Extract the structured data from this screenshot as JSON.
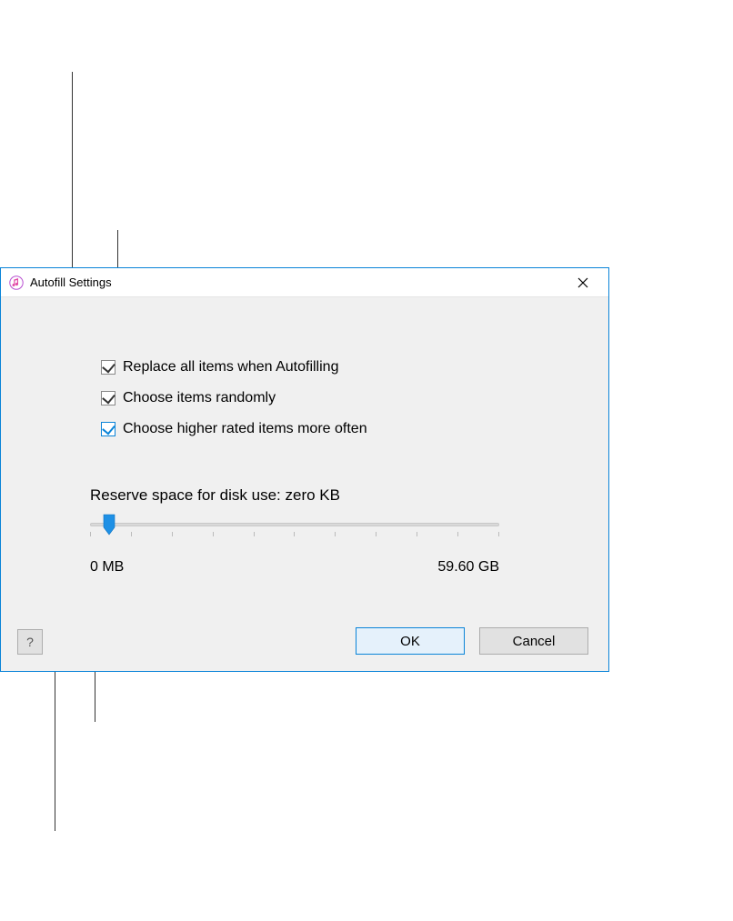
{
  "dialog": {
    "title": "Autofill Settings",
    "options": {
      "replace_all": {
        "label": "Replace all items when Autofilling",
        "checked": true
      },
      "choose_random": {
        "label": "Choose items randomly",
        "checked": true
      },
      "higher_rated": {
        "label": "Choose higher rated items more often",
        "checked": true
      }
    },
    "reserve": {
      "label": "Reserve space for disk use: zero KB",
      "min_label": "0 MB",
      "max_label": "59.60 GB"
    },
    "buttons": {
      "ok": "OK",
      "cancel": "Cancel",
      "help": "?"
    }
  },
  "icons": {
    "close": "×"
  }
}
